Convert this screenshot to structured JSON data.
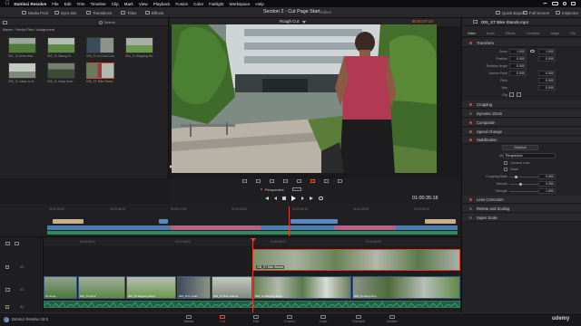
{
  "menubar": {
    "app": "DaVinci Resolve",
    "items": [
      "File",
      "Edit",
      "Trim",
      "Timeline",
      "Clip",
      "Mark",
      "View",
      "Playback",
      "Fusion",
      "Color",
      "Fairlight",
      "Workspace",
      "Help"
    ]
  },
  "toolbar": {
    "media_pool": "Media Pool",
    "sync_bin": "Sync Bin",
    "transitions": "Transitions",
    "titles": "Titles",
    "effects": "Effects",
    "project_title": "Section 2 - Cut Page Start",
    "project_status": "Edited",
    "quick_export": "Quick Export",
    "full_screen": "Full Screen",
    "inspector": "Inspector"
  },
  "media": {
    "breadcrumb": "Master / Media Files / Assignment",
    "search_label": "Search",
    "clips": [
      {
        "name": "001_Ts Drink Wat..."
      },
      {
        "name": "002_Ts Taking Dr..."
      },
      {
        "name": "003_Ts In Coat Com..."
      },
      {
        "name": "004_Ts Skipping Ro..."
      },
      {
        "name": "005_Ts Jump on B..."
      },
      {
        "name": "006_Ts Jump from..."
      },
      {
        "name": "005_ST Bike Stand..."
      }
    ]
  },
  "viewer": {
    "clip_name": "Rough Cut",
    "timecode": "00:00:07:24",
    "mode_label": "Perspective",
    "timeline_timecode": "01:00:35:18"
  },
  "inspector": {
    "clip_title": "005_ST Bike Stands.mp4",
    "tabs": [
      "Video",
      "Audio",
      "Effects",
      "Transition",
      "Image",
      "File"
    ],
    "transform": {
      "header": "Transform",
      "zoom_label": "Zoom",
      "zoom_x": "1.000",
      "zoom_y": "1.000",
      "position_label": "Position",
      "position_x": "0.000",
      "position_y": "0.000",
      "rotation_label": "Rotation Angle",
      "rotation": "0.000",
      "anchor_label": "Anchor Point",
      "anchor_x": "0.000",
      "anchor_y": "0.000",
      "pitch_label": "Pitch",
      "pitch": "0.000",
      "yaw_label": "Yaw",
      "yaw": "0.000",
      "flip_label": "Flip"
    },
    "sections": {
      "cropping": "Cropping",
      "dynamic_zoom": "Dynamic Zoom",
      "composite": "Composite",
      "speed_change": "Speed Change",
      "stabilization": "Stabilization"
    },
    "stabilization": {
      "stabilize_button": "Stabilize",
      "mode_label": "Mode",
      "mode_value": "Perspective",
      "camera_lock": "Camera Lock",
      "zoom_label": "Zoom",
      "cropping_ratio_label": "Cropping Ratio",
      "cropping_ratio": "0.900",
      "smooth_label": "Smooth",
      "smooth": "0.250",
      "strength_label": "Strength",
      "strength": "1.000"
    },
    "lower_sections": {
      "lens_correction": "Lens Correction",
      "retime_scaling": "Retime and Scaling",
      "super_scale": "Super Scale"
    }
  },
  "timeline": {
    "ruler_top": [
      "01:00:00:00",
      "01:00:08:16",
      "01:00:17:08",
      "01:00:26:00",
      "01:00:34:16",
      "01:00:43:08",
      "01:00:52:00"
    ],
    "ruler_lower": [
      "01:00:25:00",
      "01:00:30:00",
      "01:00:35:00",
      "01:00:40:00"
    ],
    "selected_clip_label": "005_ST Bike Stands",
    "clip_labels": [
      "Ts Jump...",
      "001_Ts Drink",
      "002_Ts Skipping Rope",
      "003_Ts In Coat",
      "005_ST Bike Stands",
      "003_Ts Skipping Rope",
      "006_Ts Jump from"
    ],
    "track_labels": [
      "V2",
      "V1",
      "A1"
    ]
  },
  "pages": {
    "items": [
      {
        "label": "Media"
      },
      {
        "label": "Cut"
      },
      {
        "label": "Edit"
      },
      {
        "label": "Fusion"
      },
      {
        "label": "Color"
      },
      {
        "label": "Fairlight"
      },
      {
        "label": "Deliver"
      }
    ],
    "active": "Cut",
    "version": "DaVinci Resolve 18.5",
    "watermark": "udemy"
  }
}
